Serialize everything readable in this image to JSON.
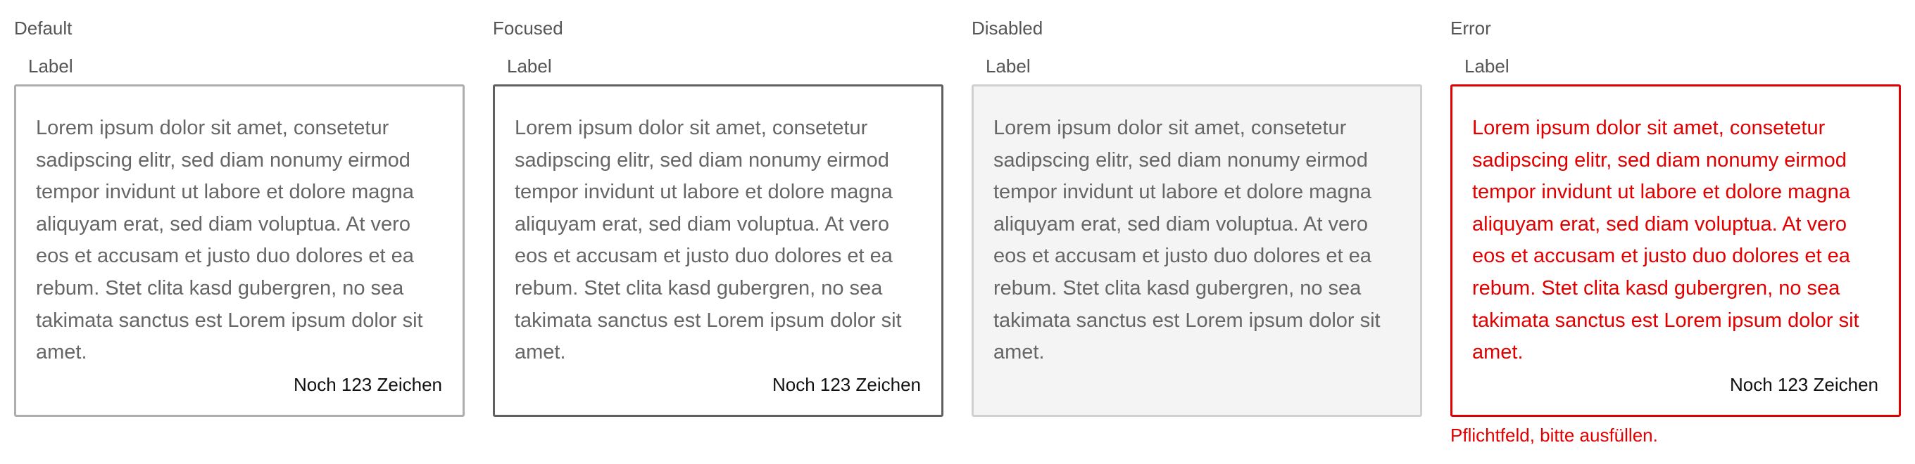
{
  "variants": [
    {
      "title": "Default",
      "label": "Label",
      "text": "Lorem ipsum dolor sit amet, consetetur sadipscing elitr, sed diam nonumy eirmod tempor invidunt ut labore et dolore magna aliquyam erat, sed diam voluptua. At vero eos et accusam et justo duo dolores et ea rebum. Stet clita kasd gubergren, no sea takimata sanctus est Lorem ipsum dolor sit amet.",
      "counter": "Noch 123 Zeichen"
    },
    {
      "title": "Focused",
      "label": "Label",
      "text": "Lorem ipsum dolor sit amet, consetetur sadipscing elitr, sed diam nonumy eirmod tempor invidunt ut labore et dolore magna aliquyam erat, sed diam voluptua. At vero eos et accusam et justo duo dolores et ea rebum. Stet clita kasd gubergren, no sea takimata sanctus est Lorem ipsum dolor sit amet.",
      "counter": "Noch 123 Zeichen"
    },
    {
      "title": "Disabled",
      "label": "Label",
      "text": "Lorem ipsum dolor sit amet, consetetur sadipscing elitr, sed diam nonumy eirmod tempor invidunt ut labore et dolore magna aliquyam erat, sed diam voluptua. At vero eos et accusam et justo duo dolores et ea rebum. Stet clita kasd gubergren, no sea takimata sanctus est Lorem ipsum dolor sit amet."
    },
    {
      "title": "Error",
      "label": "Label",
      "text": "Lorem ipsum dolor sit amet, consetetur sadipscing elitr, sed diam nonumy eirmod tempor invidunt ut labore et dolore magna aliquyam erat, sed diam voluptua. At vero eos et accusam et justo duo dolores et ea rebum. Stet clita kasd gubergren, no sea takimata sanctus est Lorem ipsum dolor sit amet.",
      "counter": "Noch 123 Zeichen",
      "error_message": "Pflichtfeld, bitte ausfüllen."
    }
  ],
  "colors": {
    "default_border": "#aeaeae",
    "focused_border": "#5f5f5f",
    "disabled_background": "#f4f4f4",
    "disabled_border": "#d0d0d0",
    "error": "#e10000",
    "secondary_text": "#555555",
    "body_text": "#666666"
  }
}
